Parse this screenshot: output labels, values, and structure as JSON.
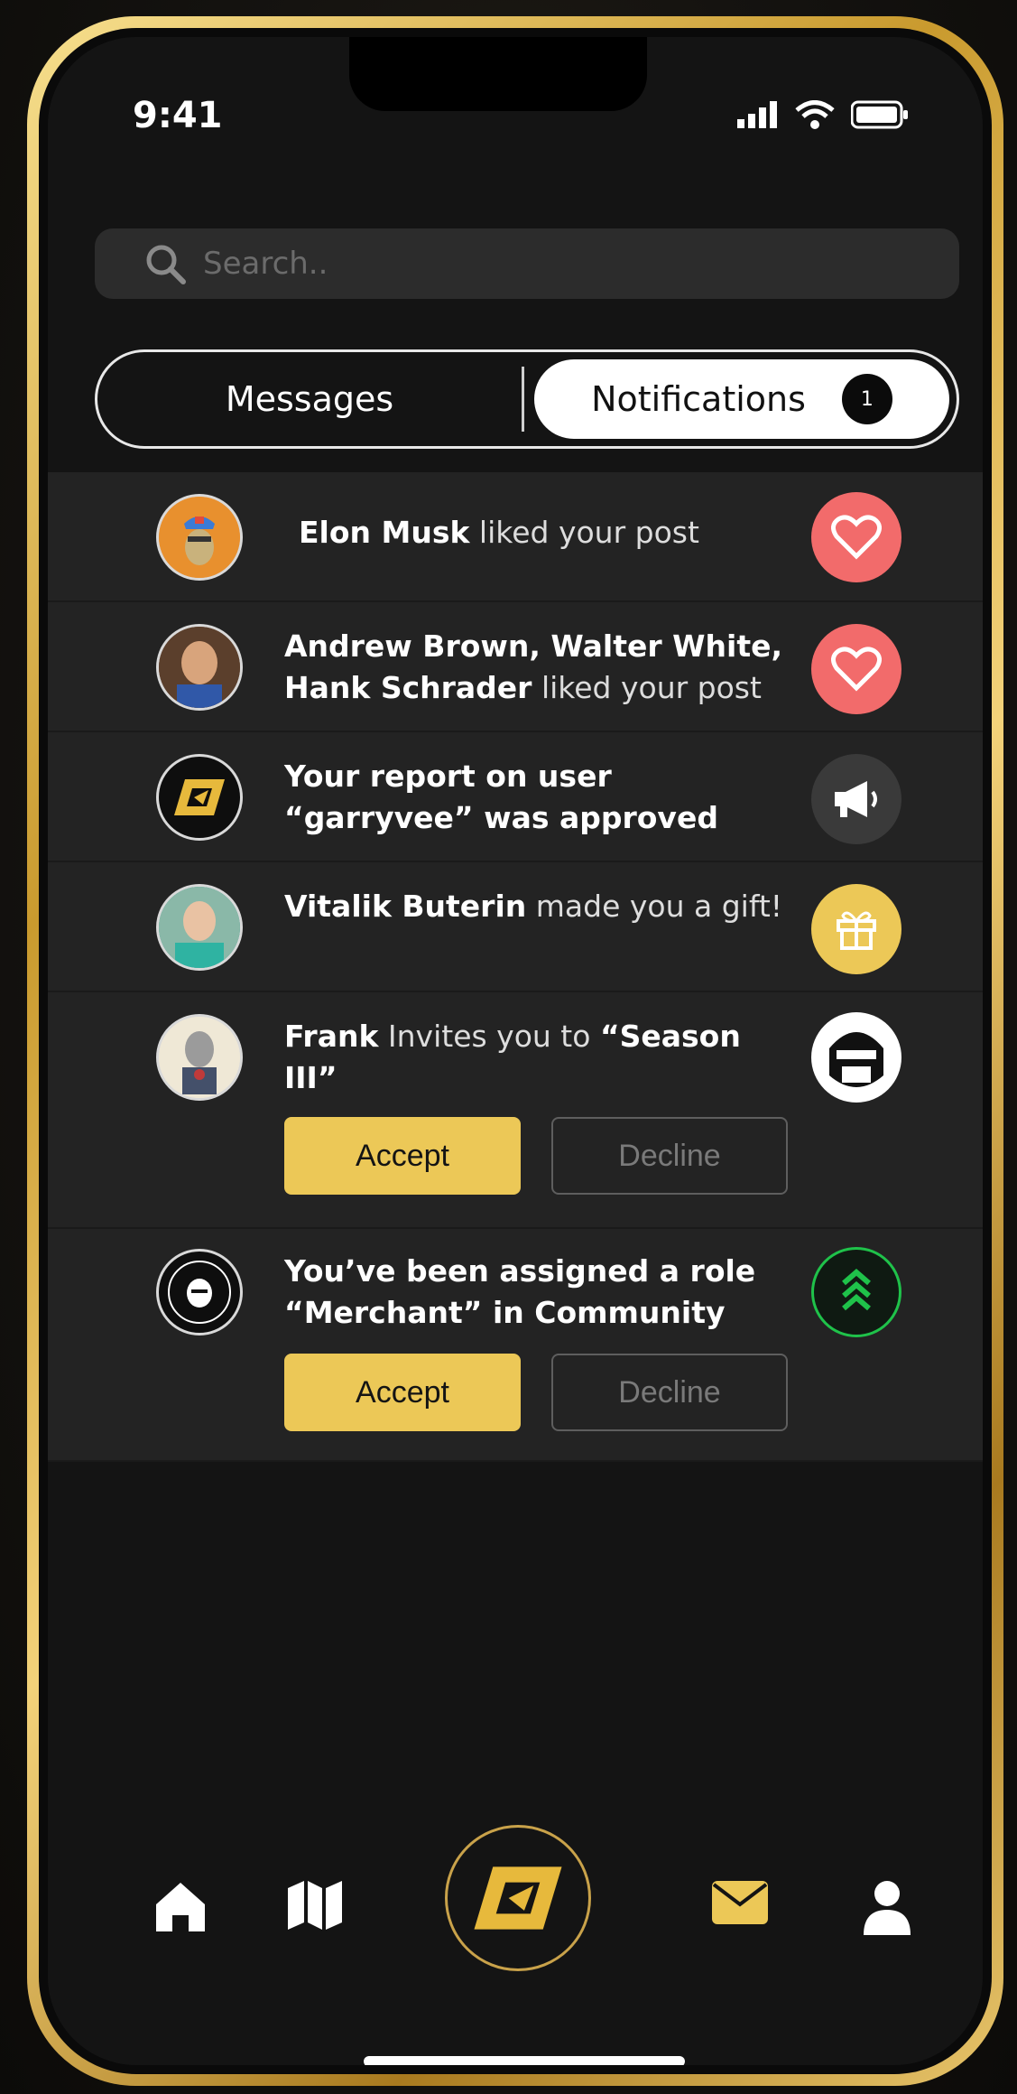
{
  "status": {
    "time": "9:41"
  },
  "search": {
    "placeholder": "Search.."
  },
  "tabs": {
    "messages_label": "Messages",
    "notifications_label": "Notifications",
    "notifications_badge": "1"
  },
  "notifications": [
    {
      "name": "Elon Musk",
      "text": " liked your post",
      "icon": "heart-icon",
      "icon_color": "#f26b6b"
    },
    {
      "name": "Andrew Brown, Walter White, Hank Schrader",
      "text": " liked your post",
      "icon": "heart-icon",
      "icon_color": "#f26b6b"
    },
    {
      "name": "Your report on user “garryvee” was approved",
      "text": "",
      "icon": "megaphone-icon",
      "icon_color": "#3a3a3a"
    },
    {
      "name": "Vitalik Buterin",
      "text": " made you a gift!",
      "icon": "gift-icon",
      "icon_color": "#ecc857"
    },
    {
      "name": "Frank",
      "text": " Invites you to ",
      "extra": "“Season III”",
      "icon": "community-avatar-icon",
      "icon_color": "#ffffff",
      "accept": "Accept",
      "decline": "Decline"
    },
    {
      "name": "You’ve been assigned a role “Merchant” in Community",
      "text": "",
      "icon": "rank-up-icon",
      "icon_color": "#1fc24a",
      "accept": "Accept",
      "decline": "Decline"
    }
  ],
  "nav": {
    "items": [
      "home-icon",
      "map-icon",
      "logo-icon",
      "mail-icon",
      "profile-icon"
    ],
    "active": "mail-icon"
  },
  "colors": {
    "accent": "#ecc857",
    "background": "#141414",
    "row": "#232323"
  }
}
